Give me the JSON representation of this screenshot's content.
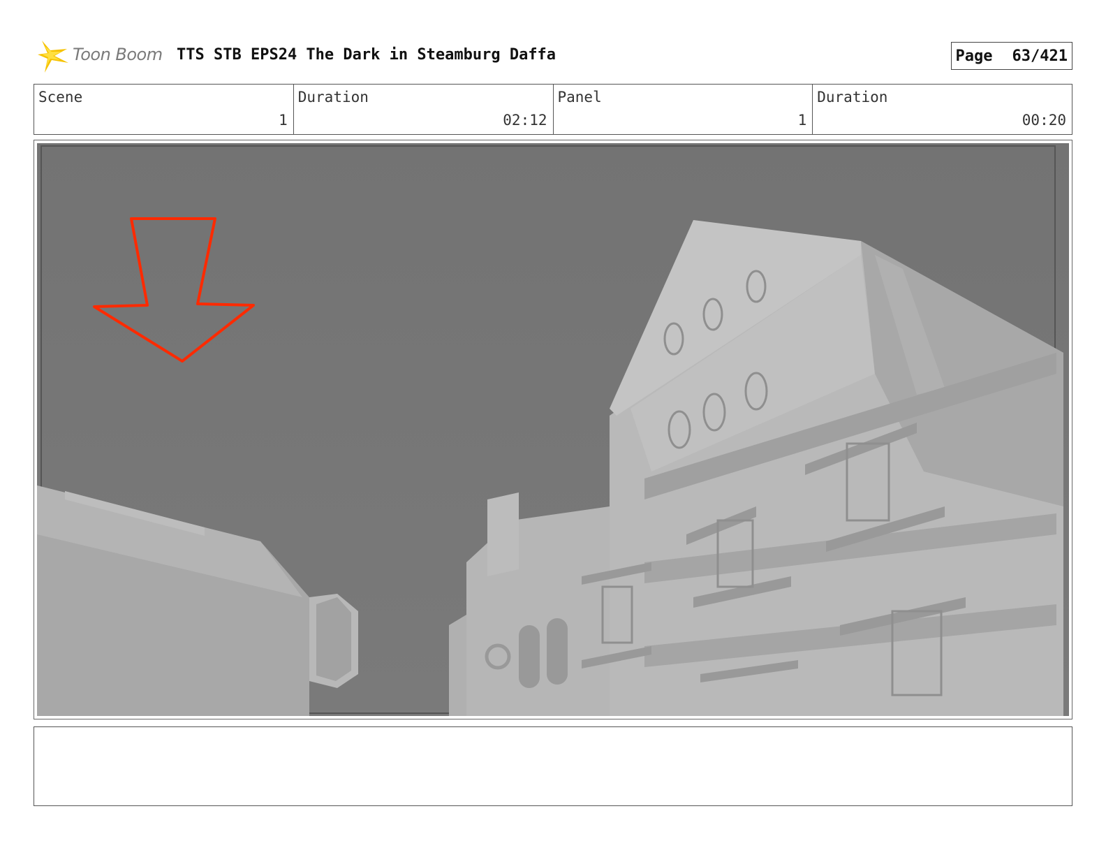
{
  "header": {
    "logo_text": "Toon Boom",
    "title": "TTS STB EPS24 The Dark in Steamburg Daffa",
    "page_label": "Page",
    "page_value": "63/421"
  },
  "info": {
    "scene_label": "Scene",
    "scene_value": "1",
    "scene_duration_label": "Duration",
    "scene_duration_value": "02:12",
    "panel_label": "Panel",
    "panel_value": "1",
    "panel_duration_label": "Duration",
    "panel_duration_value": "00:20"
  },
  "panel": {
    "description": "",
    "arrow_color": "#ff2a00",
    "sky_color": "#777777",
    "building_color": "#b3b3b3"
  },
  "notes": {
    "text": ""
  }
}
